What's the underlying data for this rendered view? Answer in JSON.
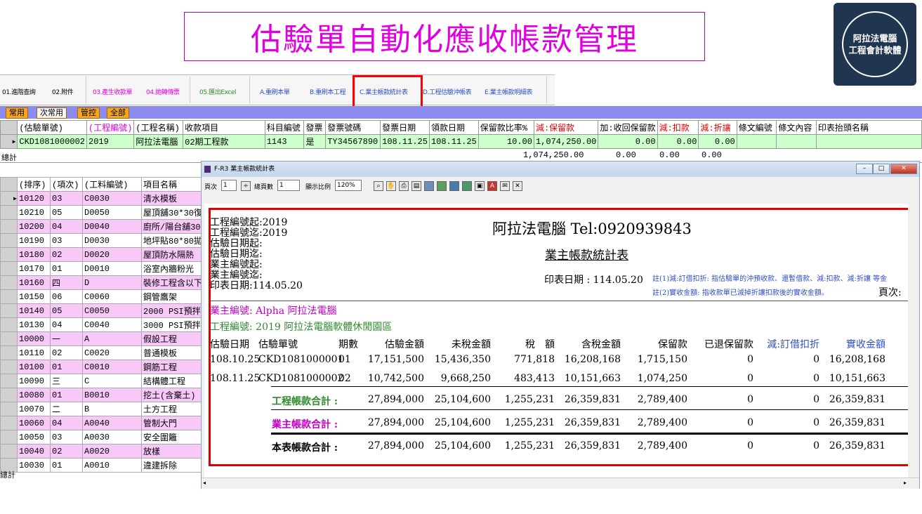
{
  "banner": {
    "title": "估驗單自動化應收帳款管理"
  },
  "logo": {
    "line1": "阿拉法電腦",
    "line2": "工程會計軟體"
  },
  "toolbar": {
    "items": [
      "01.進階查詢",
      "02.附件",
      "03.產生收款單",
      "04.拋轉傳票",
      "05.匯出Excel",
      "A.重刷本單",
      "B.重刷本工程",
      "C.業主帳款統計表",
      "D.工程估驗沖帳表",
      "E.業主帳款明細表"
    ]
  },
  "tabs": [
    "常用",
    "次常用",
    "管控",
    "全部"
  ],
  "top_grid": {
    "headers": [
      "(估驗單號)",
      "(工程編號)",
      "(工程名稱)",
      "收款項目",
      "科目編號",
      "發票",
      "發票號碼",
      "發票日期",
      "領款日期",
      "保留款比率%",
      "減:保留款",
      "加:收回保留款",
      "減:扣款",
      "減:折讓",
      "條文編號",
      "條文內容",
      "印表抬頭名稱"
    ],
    "row": [
      "CKD1081000002",
      "2019",
      "阿拉法電腦",
      "02期工程款",
      "1143",
      "是",
      "TY34567890",
      "108.11.25",
      "108.11.25",
      "10.00",
      "1,074,250.00",
      "0.00",
      "0.00",
      "0.00",
      "",
      "",
      ""
    ],
    "sum_label": "總計",
    "sum": [
      "1,074,250.00",
      "0.00",
      "0.00",
      "0.00"
    ]
  },
  "left_grid": {
    "headers": [
      "(排序)",
      "(項次)",
      "(工料編號)",
      "項目名稱"
    ],
    "rows": [
      [
        "10120",
        "03",
        "C0030",
        "清水模板"
      ],
      [
        "10210",
        "05",
        "D0050",
        "屋頂舖30*30復"
      ],
      [
        "10200",
        "04",
        "D0040",
        "廚所/陽台舖30*"
      ],
      [
        "10190",
        "03",
        "D0030",
        "地坪貼80*80拋"
      ],
      [
        "10180",
        "02",
        "D0020",
        "屋頂防水隔熱"
      ],
      [
        "10170",
        "01",
        "D0010",
        "浴室內牆粉光"
      ],
      [
        "10160",
        "四",
        "D",
        "裝修工程含以下"
      ],
      [
        "10150",
        "06",
        "C0060",
        "鋼管鷹架"
      ],
      [
        "10140",
        "05",
        "C0050",
        "2000 PSI預拌混"
      ],
      [
        "10130",
        "04",
        "C0040",
        "3000 PSI預拌混"
      ],
      [
        "10000",
        "一",
        "A",
        "假設工程"
      ],
      [
        "10110",
        "02",
        "C0020",
        "普通模板"
      ],
      [
        "10100",
        "01",
        "C0010",
        "鋼筋工程"
      ],
      [
        "10090",
        "三",
        "C",
        "結構體工程"
      ],
      [
        "10080",
        "01",
        "B0010",
        "挖土(含棄土)"
      ],
      [
        "10070",
        "二",
        "B",
        "土方工程"
      ],
      [
        "10060",
        "04",
        "A0040",
        "管制大門"
      ],
      [
        "10050",
        "03",
        "A0030",
        "安全圍籬"
      ],
      [
        "10040",
        "02",
        "A0020",
        "放樣"
      ],
      [
        "10030",
        "01",
        "A0010",
        "違建拆除"
      ]
    ],
    "sum_label": "總計"
  },
  "window": {
    "title": "F-R3 業主帳款統計表",
    "page_label": "頁次",
    "page_value": "1",
    "total_label": "總頁數",
    "total_value": "1",
    "zoom_label": "顯示比例",
    "zoom_value": "120%"
  },
  "report": {
    "filters": [
      "工程編號起:2019",
      "工程編號迄:2019",
      "估驗日期起:",
      "估驗日期迄:",
      "業主編號起:",
      "業主編號迄:",
      "印表日期:114.05.20"
    ],
    "company": "阿拉法電腦 Tel:0920939843",
    "title": "業主帳款統計表",
    "print_date": "印表日期 : 114.05.20",
    "note1": "註(1)減:訂借扣折: 指估驗單的沖預收款、還暫借款、減:扣款、減:折讓 等金",
    "note2": "註(2)實收金額: 指收款單已減掉折讓扣款後的實收金額。",
    "page_label": "頁次:",
    "owner": "業主編號: Alpha 阿拉法電腦",
    "project": "工程編號: 2019 阿拉法電腦軟體休閒園區",
    "columns": [
      "估驗日期",
      "估驗單號",
      "期數",
      "估驗金額",
      "未稅金額",
      "稅　額",
      "含稅金額",
      "保留款",
      "已退保留款",
      "減:訂借扣折",
      "實收金額"
    ],
    "rows": [
      [
        "108.10.25",
        "CKD1081000001",
        "01",
        "17,151,500",
        "15,436,350",
        "771,818",
        "16,208,168",
        "1,715,150",
        "0",
        "0",
        "16,208,168"
      ],
      [
        "108.11.25",
        "CKD1081000002",
        "02",
        "10,742,500",
        "9,668,250",
        "483,413",
        "10,151,663",
        "1,074,250",
        "0",
        "0",
        "10,151,663"
      ]
    ],
    "totals": [
      {
        "label": "工程帳款合計 :",
        "values": [
          "27,894,000",
          "25,104,600",
          "1,255,231",
          "26,359,831",
          "2,789,400",
          "0",
          "0",
          "26,359,831"
        ]
      },
      {
        "label": "業主帳款合計 :",
        "values": [
          "27,894,000",
          "25,104,600",
          "1,255,231",
          "26,359,831",
          "2,789,400",
          "0",
          "0",
          "26,359,831"
        ]
      },
      {
        "label": "本表帳款合計 :",
        "values": [
          "27,894,000",
          "25,104,600",
          "1,255,231",
          "26,359,831",
          "2,789,400",
          "0",
          "0",
          "26,359,831"
        ]
      }
    ]
  },
  "colors": {
    "accent_pink": "#e000e0",
    "highlight_red": "#e00000",
    "tab_bar": "#8c8cf0",
    "tab_orange": "#f5a623",
    "green_text": "#2e8b2e",
    "blue_text": "#3050c0"
  }
}
